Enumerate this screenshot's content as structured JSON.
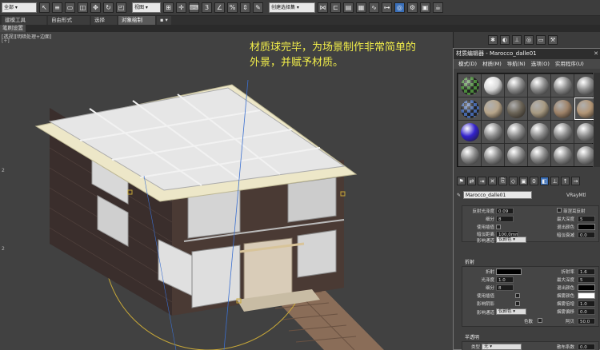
{
  "toolbar": {
    "selection_filter": "全部",
    "view_select": "视图",
    "named_set": "创建选择集",
    "icons": [
      "undo-icon",
      "redo-icon",
      "link-icon",
      "unlink-icon",
      "bind-icon",
      "select-icon",
      "select-name-icon",
      "rect-select-icon",
      "window-icon",
      "move-icon",
      "rotate-icon",
      "scale-icon",
      "snap-icon",
      "angle-snap-icon",
      "percent-snap-icon",
      "spinner-snap-icon",
      "mirror-icon",
      "align-icon",
      "layer-icon",
      "graph-icon",
      "material-editor-icon",
      "render-setup-icon",
      "render-frame-icon",
      "render-icon"
    ]
  },
  "ribbon": {
    "tabs": [
      "建模工具",
      "自由形式",
      "选择",
      "对象绘制"
    ],
    "dot_menu": "▪ ▾",
    "subtab": "笔刷设置"
  },
  "viewport": {
    "label": "[透视][明暗处理+边面]",
    "side_labels": [
      "[+] ",
      "2 ",
      "2 "
    ],
    "annotation_line1": "材质球完毕，为场景制作非常简单的",
    "annotation_line2": "外景，并赋予材质。"
  },
  "command_panel": {
    "icons": [
      "create-icon",
      "modify-icon",
      "hierarchy-icon",
      "motion-icon",
      "display-icon",
      "utilities-icon"
    ]
  },
  "material_editor": {
    "title": "材质编辑器 - Marocco_dalle01",
    "menu": [
      "模式(D)",
      "材质(M)",
      "导航(N)",
      "选项(O)",
      "实用程序(U)"
    ],
    "material_name": "Marocco_dalle01",
    "material_type": "VRayMtl",
    "slots": [
      {
        "type": "checker",
        "color": "#4a8a3a"
      },
      {
        "type": "plain",
        "color": "#d8d8d8"
      },
      {
        "type": "plain",
        "color": "#8a8a8a"
      },
      {
        "type": "plain",
        "color": "#8a8a8a"
      },
      {
        "type": "plain",
        "color": "#8a8a8a"
      },
      {
        "type": "plain",
        "color": "#8a8a8a"
      },
      {
        "type": "checker",
        "color": "#4466aa"
      },
      {
        "type": "stone",
        "color": "#b7a58a"
      },
      {
        "type": "stone",
        "color": "#6a6356"
      },
      {
        "type": "stone",
        "color": "#a79a82"
      },
      {
        "type": "stone",
        "color": "#9e8268"
      },
      {
        "type": "selected",
        "color": "#b29575"
      },
      {
        "type": "plain",
        "color": "#3322cc"
      },
      {
        "type": "plain",
        "color": "#8a8a8a"
      },
      {
        "type": "plain",
        "color": "#8a8a8a"
      },
      {
        "type": "plain",
        "color": "#8a8a8a"
      },
      {
        "type": "plain",
        "color": "#8a8a8a"
      },
      {
        "type": "plain",
        "color": "#8a8a8a"
      },
      {
        "type": "plain",
        "color": "#8a8a8a"
      },
      {
        "type": "plain",
        "color": "#8a8a8a"
      },
      {
        "type": "plain",
        "color": "#8a8a8a"
      },
      {
        "type": "plain",
        "color": "#8a8a8a"
      },
      {
        "type": "plain",
        "color": "#8a8a8a"
      },
      {
        "type": "plain",
        "color": "#8a8a8a"
      }
    ],
    "reflection": {
      "gloss_label": "反射光泽度",
      "gloss_value": "0.09",
      "subdivs_label": "细分",
      "subdivs_value": "8",
      "use_interp_label": "使用插值",
      "dim_dist_label": "暗淡距离",
      "dim_dist_value": "100.0mm",
      "affect_channels_label": "影响通道",
      "affect_channels_value": "仅颜色",
      "fresnel_label": "菲涅耳反射",
      "max_depth_label": "最大深度",
      "max_depth_value": "5",
      "exit_color_label": "退出颜色",
      "dim_falloff_label": "暗淡衰减",
      "dim_falloff_value": "0.0"
    },
    "refraction": {
      "section_title": "折射",
      "refract_label": "折射",
      "gloss_label": "光泽度",
      "gloss_value": "1.0",
      "subdivs_label": "细分",
      "subdivs_value": "8",
      "use_interp_label": "使用插值",
      "affect_shadows_label": "影响阴影",
      "affect_channels_label": "影响通道",
      "affect_channels_value": "仅颜色",
      "dispersion_label": "色散",
      "ior_label": "折射率",
      "ior_value": "1.6",
      "max_depth_label": "最大深度",
      "max_depth_value": "5",
      "exit_color_label": "退出颜色",
      "fog_color_label": "烟雾颜色",
      "fog_mult_label": "烟雾倍增",
      "fog_mult_value": "1.0",
      "fog_bias_label": "烟雾偏移",
      "fog_bias_value": "0.0",
      "abbe_label": "阿贝",
      "abbe_value": "50.0"
    },
    "translucency": {
      "section_title": "半透明",
      "type_label": "类型",
      "type_value": "无",
      "scatter_label": "散布系数",
      "scatter_value": "0.0"
    }
  }
}
